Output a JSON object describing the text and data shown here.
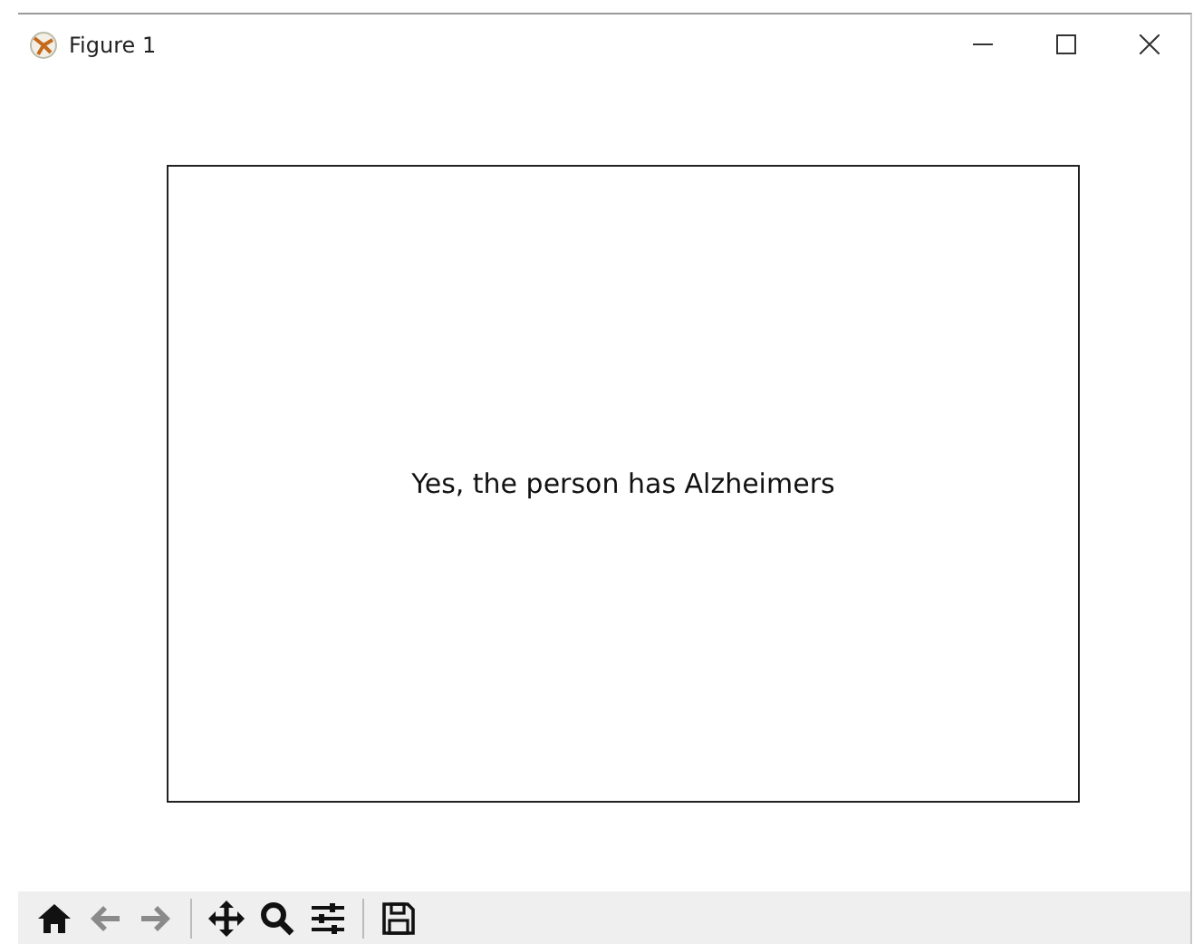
{
  "window": {
    "title": "Figure 1"
  },
  "figure": {
    "text": "Yes, the person has Alzheimers"
  },
  "toolbar": {
    "tools": [
      {
        "kind": "home",
        "disabled": false
      },
      {
        "kind": "back",
        "disabled": true
      },
      {
        "kind": "forward",
        "disabled": true
      },
      {
        "kind": "separator"
      },
      {
        "kind": "pan",
        "disabled": false
      },
      {
        "kind": "zoom",
        "disabled": false
      },
      {
        "kind": "subplots",
        "disabled": false
      },
      {
        "kind": "separator"
      },
      {
        "kind": "save",
        "disabled": false
      }
    ]
  }
}
